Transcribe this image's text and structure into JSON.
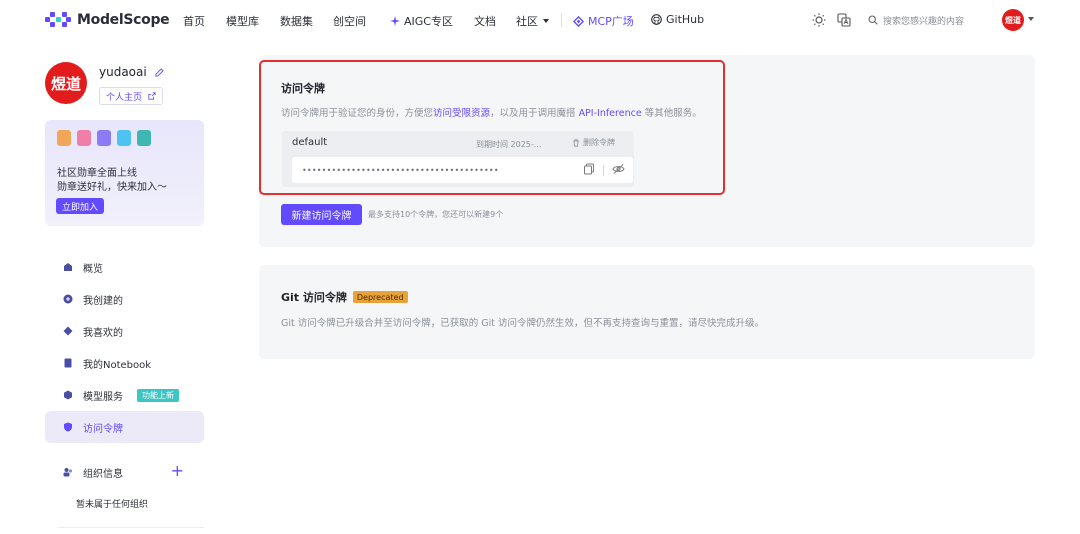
{
  "nav": {
    "logo_text": "ModelScope",
    "items": [
      {
        "label": "首页"
      },
      {
        "label": "模型库"
      },
      {
        "label": "数据集"
      },
      {
        "label": "创空间"
      },
      {
        "label": "AIGC专区"
      },
      {
        "label": "文档"
      },
      {
        "label": "社区"
      },
      {
        "label": "MCP广场"
      },
      {
        "label": "GitHub"
      }
    ],
    "search_placeholder": "搜索您感兴趣的内容",
    "avatar_text": "煜道"
  },
  "sidebar": {
    "username": "yudaoai",
    "avatar_text": "煜道",
    "homepage_label": "个人主页",
    "promo": {
      "line1": "社区勋章全面上线",
      "line2": "勋章送好礼，快来加入～",
      "button": "立即加入",
      "badge_colors": [
        "#f2a65a",
        "#f07fa8",
        "#8b7cf6",
        "#4cc3f0",
        "#3fb6b2"
      ]
    },
    "menu": [
      {
        "label": "概览",
        "icon": "home-icon"
      },
      {
        "label": "我创建的",
        "icon": "create-icon"
      },
      {
        "label": "我喜欢的",
        "icon": "favorite-icon"
      },
      {
        "label": "我的Notebook",
        "icon": "notebook-icon"
      },
      {
        "label": "模型服务",
        "icon": "cube-icon",
        "tag": "功能上新"
      },
      {
        "label": "访问令牌",
        "icon": "shield-icon",
        "active": true
      }
    ],
    "org_title": "组织信息",
    "org_empty": "暂未属于任何组织"
  },
  "access_token": {
    "title": "访问令牌",
    "desc_prefix": "访问令牌用于验证您的身份，方便您",
    "desc_link1": "访问受限资源",
    "desc_middle": "，以及用于调用魔搭 ",
    "desc_link2": "API-Inference",
    "desc_suffix": " 等其他服务。",
    "token": {
      "name": "default",
      "expiry": "到期时间 2025-...",
      "delete_label": "删除令牌",
      "masked_value": "••••••••••••••••••••••••••••••••••••••••"
    },
    "new_button": "新建访问令牌",
    "limit_hint": "最多支持10个令牌，您还可以新建9个"
  },
  "git_token": {
    "title": "Git 访问令牌",
    "badge": "Deprecated",
    "desc": "Git 访问令牌已升级合并至访问令牌，已获取的 Git 访问令牌仍然生效，但不再支持查询与重置，请尽快完成升级。"
  },
  "colors": {
    "accent": "#624aff",
    "highlight": "#e0302f",
    "avatar": "#e21c1c",
    "new_tag": "#3dc5c4",
    "deprecated": "#e8a23a"
  }
}
